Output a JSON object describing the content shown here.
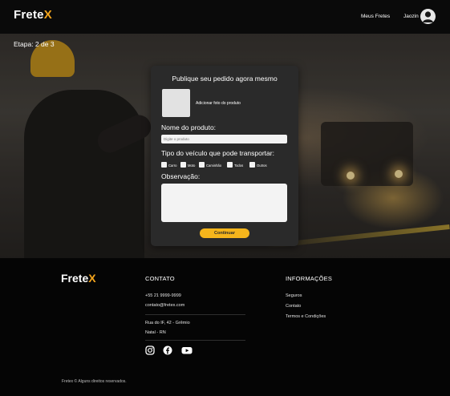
{
  "header": {
    "logo_text": "Frete",
    "logo_accent": "X",
    "nav_link": "Meus Fretes",
    "user_name": "Jaozin"
  },
  "step": {
    "label": "Etapa: 2 de 3"
  },
  "form": {
    "title": "Publique seu pedido agora mesmo",
    "photo_label": "Adicionar foto do produto",
    "product_label": "Nome do produto:",
    "product_placeholder": "Digite o produto",
    "vehicle_label": "Tipo do veículo que pode transportar:",
    "vehicle_options": [
      "Carro",
      "Moto",
      "Caminhão",
      "Todos",
      "Outros"
    ],
    "observation_label": "Observação:",
    "observation_value": "",
    "continue_label": "Continuar"
  },
  "footer": {
    "logo_text": "Frete",
    "logo_accent": "X",
    "contact_title": "CONTATO",
    "phone": "+55 21 9999-9999",
    "email": "contato@fretex.com",
    "address_line1": "Rua do IF, 42 - Grêmio",
    "address_line2": "Natal - RN",
    "info_title": "INFORMAÇÕES",
    "info_links": [
      "Seguros",
      "Contato",
      "Termos e Condições"
    ],
    "social_icons": [
      "instagram-icon",
      "facebook-icon",
      "youtube-icon"
    ],
    "copyright": "Fretex © Alguns direitos reservados."
  },
  "colors": {
    "accent": "#f5a51c",
    "button": "#f5b51c",
    "card": "#2a2a2a",
    "background": "#0a0a0a"
  }
}
